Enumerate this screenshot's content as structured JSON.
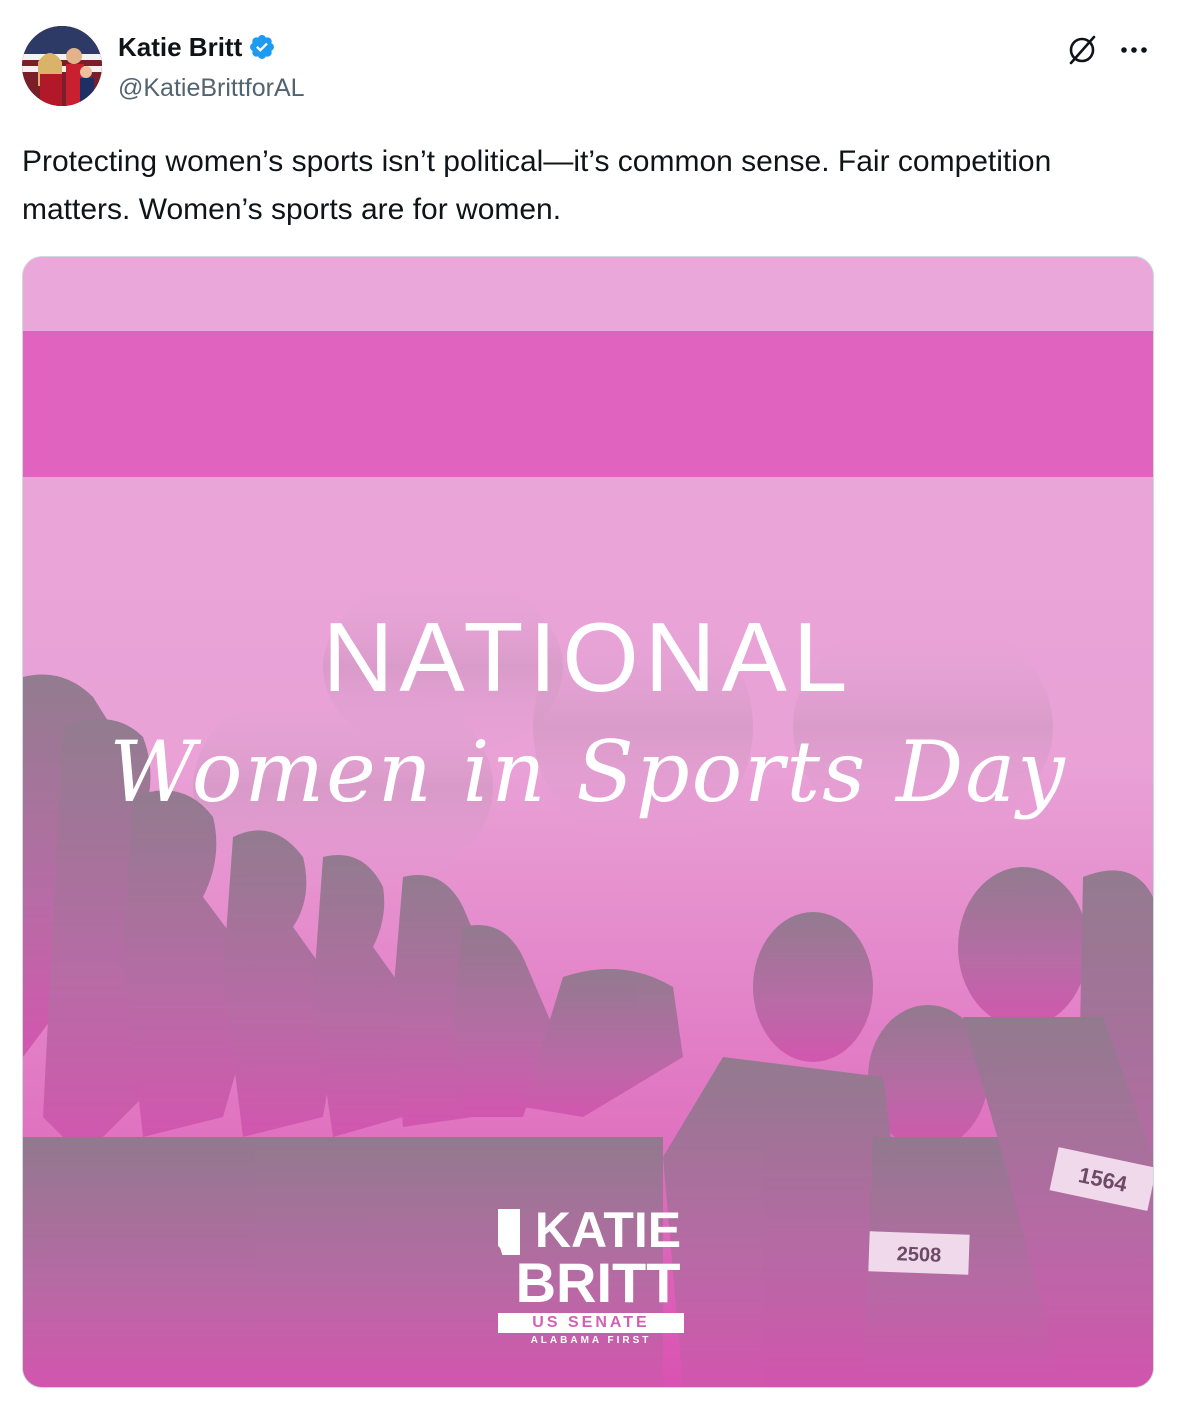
{
  "author": {
    "display_name": "Katie Britt",
    "handle": "@KatieBrittforAL",
    "verified": true,
    "avatar_icon": "profile-photo"
  },
  "actions": {
    "grok_icon": "grok-icon",
    "more_icon": "more-dots-icon"
  },
  "tweet": {
    "text": "Protecting women’s sports isn’t political—it’s common sense. Fair competition matters. Women’s sports are for women."
  },
  "media": {
    "headline": "NATIONAL",
    "script_title": "Women in Sports Day",
    "logo": {
      "line1": "KATIE",
      "line2": "BRITT",
      "office": "US SENATE",
      "tagline": "ALABAMA FIRST"
    },
    "bib_numbers": [
      "2508",
      "1564"
    ],
    "colors": {
      "band": "#e063c0",
      "background_top": "#eea3d8",
      "background_bottom": "#d64fae"
    }
  },
  "colors": {
    "verified_badge": "#1d9bf0",
    "secondary_text": "#536471"
  }
}
